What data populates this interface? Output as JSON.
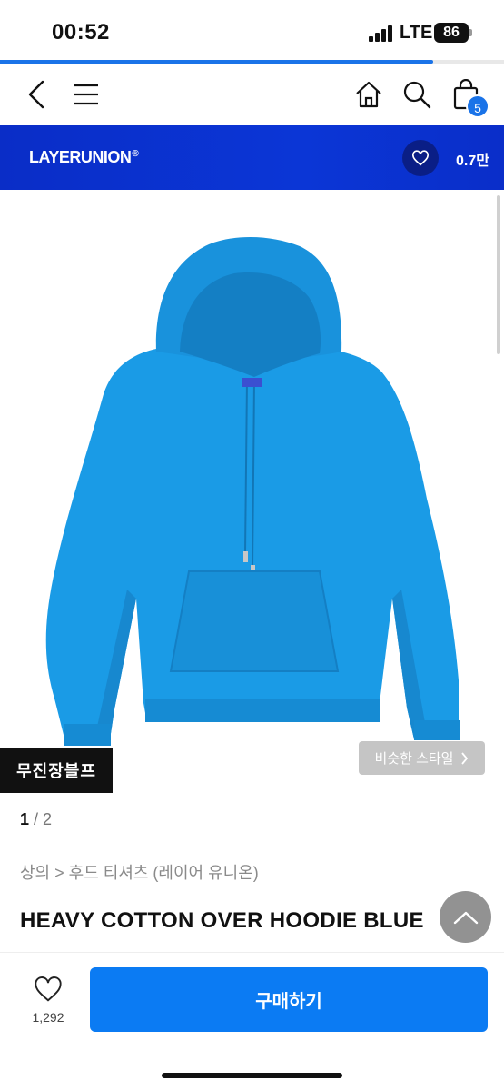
{
  "status_bar": {
    "time": "00:52",
    "network": "LTE",
    "battery": "86"
  },
  "page_load_progress": 0.86,
  "nav": {
    "cart_count": "5"
  },
  "brand": {
    "name": "LAYERUNION",
    "registered_mark": "®",
    "like_count": "0.7만"
  },
  "product": {
    "image_icon": "blue-hoodie-image",
    "tag": "무진장블프",
    "similar_style_label": "비슷한 스타일",
    "image_index": "1",
    "image_total": "/ 2",
    "category_path": "상의 > 후드 티셔츠 (레이어 유니온)",
    "title": "HEAVY COTTON OVER HOODIE BLUE"
  },
  "bottom_bar": {
    "wish_count": "1,292",
    "buy_label": "구매하기"
  },
  "colors": {
    "accent": "#0b7bf3",
    "brand_banner": "#0a2dc7",
    "hoodie": "#1a9be6"
  }
}
